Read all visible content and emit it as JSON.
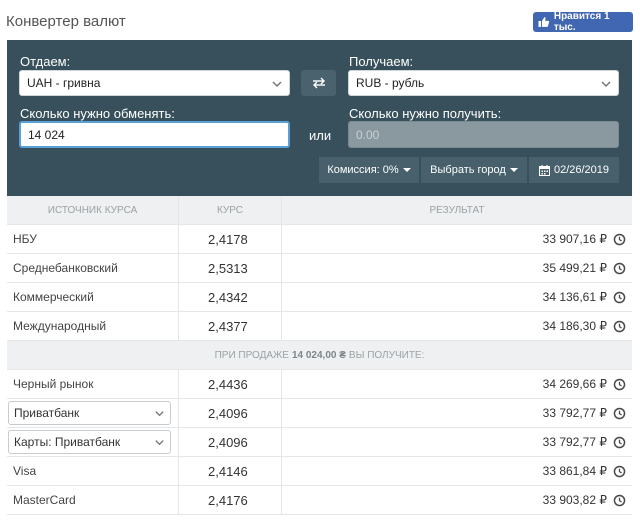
{
  "header": {
    "title": "Конвертер валют",
    "like_label": "Нравится 1 тыс."
  },
  "converter": {
    "give_label": "Отдаем:",
    "give_currency": "UAH - гривна",
    "get_label": "Получаем:",
    "get_currency": "RUB - рубль",
    "swap_symbol": "⇄",
    "amount_label": "Сколько нужно обменять:",
    "amount_value": "14 024",
    "or_label": "или",
    "receive_label": "Сколько нужно получить:",
    "receive_placeholder": "0.00",
    "commission_label": "Комиссия: 0%",
    "city_label": "Выбрать город",
    "date_label": "02/26/2019"
  },
  "table": {
    "headers": [
      "ИСТОЧНИК КУРСА",
      "КУРС",
      "РЕЗУЛЬТАТ"
    ],
    "rows_top": [
      {
        "source": "НБУ",
        "rate": "2,4178",
        "result": "33 907,16 ₽"
      },
      {
        "source": "Среднебанковский",
        "rate": "2,5313",
        "result": "35 499,21 ₽"
      },
      {
        "source": "Коммерческий",
        "rate": "2,4342",
        "result": "34 136,61 ₽"
      },
      {
        "source": "Международный",
        "rate": "2,4377",
        "result": "34 186,30 ₽"
      }
    ],
    "sell_prefix": "ПРИ ПРОДАЖЕ",
    "sell_amount": "14 024,00 ₴",
    "sell_suffix": "ВЫ ПОЛУЧИТЕ:",
    "rows_bottom": [
      {
        "source": "Черный рынок",
        "rate": "2,4436",
        "result": "34 269,66 ₽",
        "select": false
      },
      {
        "source": "Приватбанк",
        "rate": "2,4096",
        "result": "33 792,77 ₽",
        "select": true
      },
      {
        "source": "Карты: Приватбанк",
        "rate": "2,4096",
        "result": "33 792,77 ₽",
        "select": true
      },
      {
        "source": "Visa",
        "rate": "2,4146",
        "result": "33 861,84 ₽",
        "select": false
      },
      {
        "source": "MasterCard",
        "rate": "2,4176",
        "result": "33 903,82 ₽",
        "select": false
      }
    ]
  },
  "colors": {
    "panel": "#37505b",
    "like": "#4267b2",
    "active_border": "#5aa0d8"
  },
  "icons": [
    "thumbs-up-icon",
    "chevron-down-icon",
    "swap-icon",
    "calendar-icon",
    "clock-icon"
  ]
}
